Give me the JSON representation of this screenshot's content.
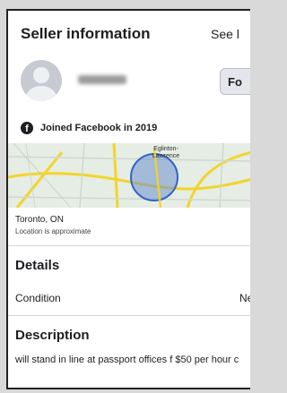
{
  "seller": {
    "title": "Seller information",
    "see_link": "See l",
    "follow_label": "Fo",
    "joined_text": "Joined Facebook in 2019"
  },
  "map": {
    "label": "Eglinton-Lawrence",
    "city": "Toronto, ON",
    "note": "Location is approximate"
  },
  "details": {
    "title": "Details",
    "condition_label": "Condition",
    "condition_value": "Ne"
  },
  "description": {
    "title": "Description",
    "text": "will stand in line at passport offices f $50 per hour c"
  },
  "colors": {
    "map_circle": "#2f64c8",
    "map_road": "#f2d52a"
  },
  "icons": [
    "facebook-icon",
    "avatar-placeholder-icon"
  ]
}
